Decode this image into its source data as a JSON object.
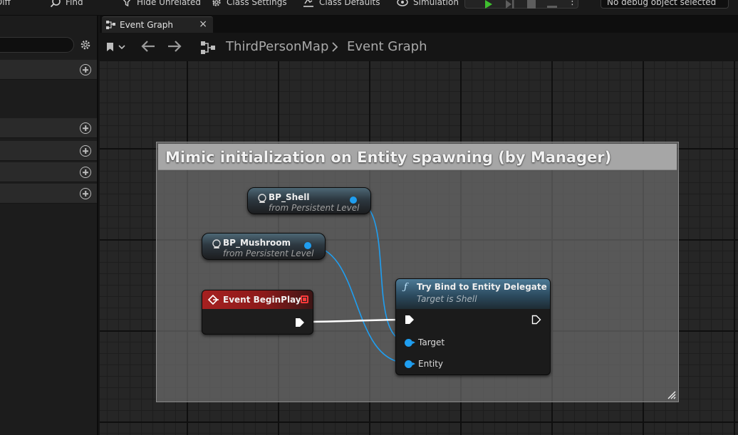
{
  "toolbar": {
    "items": [
      "Diff",
      "Find",
      "Hide Unrelated",
      "Class Settings",
      "Class Defaults",
      "Simulation"
    ],
    "debug_object": "No debug object selected"
  },
  "tab": {
    "label": "Event Graph",
    "close": "×"
  },
  "breadcrumb": {
    "level": "ThirdPersonMap",
    "separator": ">",
    "graph": "Event Graph"
  },
  "comment": {
    "title": "Mimic initialization on Entity spawning (by Manager)"
  },
  "nodes": {
    "shell": {
      "title": "BP_Shell",
      "subtitle": "from Persistent Level"
    },
    "mushroom": {
      "title": "BP_Mushroom",
      "subtitle": "from Persistent Level"
    },
    "begin_play": {
      "title": "Event BeginPlay"
    },
    "bind": {
      "title": "Try Bind to Entity Delegate",
      "subtitle": "Target is Shell",
      "pins": [
        "Target",
        "Entity"
      ]
    }
  },
  "colors": {
    "object_pin": "#1f9ef0",
    "event_header": "#a52020",
    "function_header": "#4d7a96",
    "comment_bg": "#7a7a7a"
  }
}
